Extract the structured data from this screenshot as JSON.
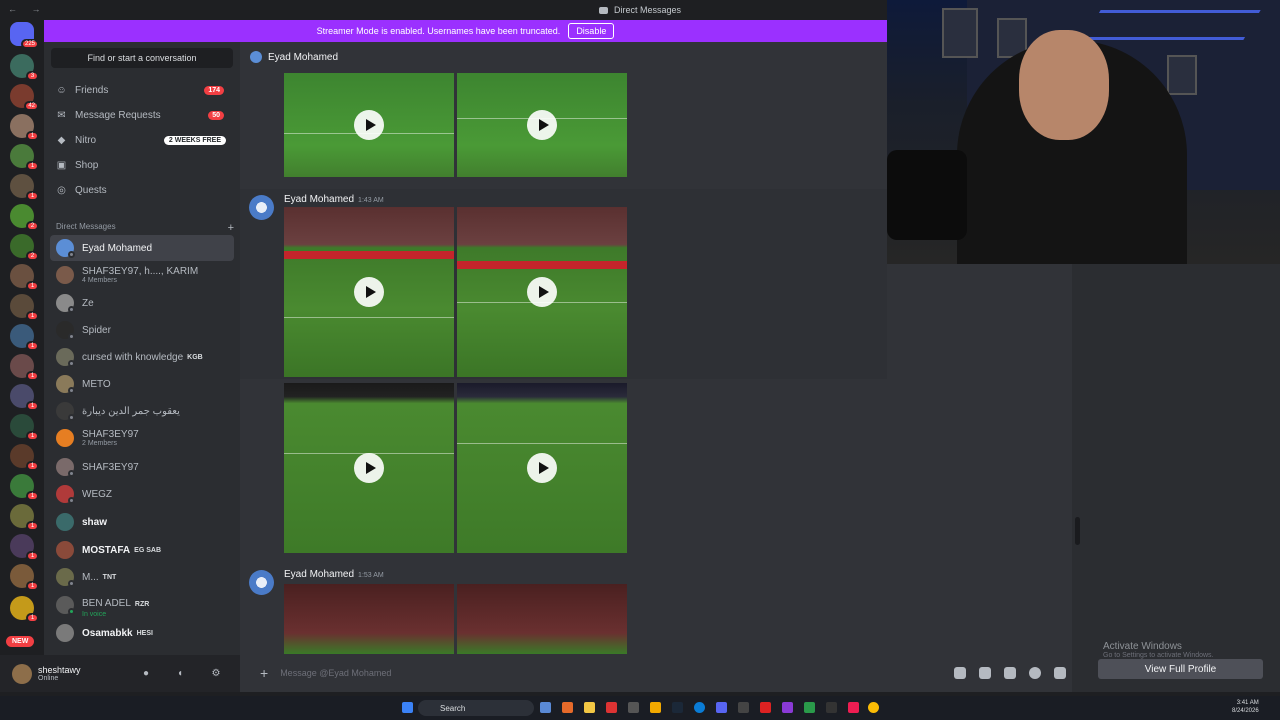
{
  "titlebar": {
    "title": "Direct Messages"
  },
  "streamer": {
    "text": "Streamer Mode is enabled. Usernames have been truncated.",
    "button": "Disable"
  },
  "servers": {
    "home_badge": "225",
    "new_badge": "NEW",
    "badges": [
      "3",
      "42",
      "1",
      "1",
      "1",
      "2",
      "2",
      "1",
      "1",
      "1",
      "1",
      "1",
      "1",
      "1",
      "1",
      "1",
      "1",
      "1",
      "1"
    ]
  },
  "sidebar": {
    "search_placeholder": "Find or start a conversation",
    "nav": [
      {
        "label": "Friends",
        "count": "174"
      },
      {
        "label": "Message Requests",
        "count": "50"
      },
      {
        "label": "Nitro",
        "pill": "2 WEEKS FREE"
      },
      {
        "label": "Shop"
      },
      {
        "label": "Quests"
      }
    ],
    "dm_header": "Direct Messages",
    "dm_add": "+",
    "dms": [
      {
        "name": "Eyad Mohamed",
        "active": true
      },
      {
        "name": "SHAF3EY97, h...., KARIM",
        "sub": "4 Members"
      },
      {
        "name": "Ze"
      },
      {
        "name": "Spider"
      },
      {
        "name": "cursed with knowledge",
        "tag": "KGB"
      },
      {
        "name": "METO"
      },
      {
        "name": "يعقوب جمر الدين ديبارة"
      },
      {
        "name": "SHAF3EY97",
        "sub": "2 Members"
      },
      {
        "name": "SHAF3EY97"
      },
      {
        "name": "WEGZ"
      },
      {
        "name": "shaw",
        "bold": true
      },
      {
        "name": "MOSTAFA",
        "tag": "EG SAB",
        "bold": true
      },
      {
        "name": "M...",
        "tag": "TNT"
      },
      {
        "name": "BEN ADEL",
        "tag": "RZR",
        "sub": "In voice"
      },
      {
        "name": "Osamabkk",
        "tag": "HESI",
        "bold": true
      }
    ]
  },
  "user": {
    "name": "sheshtawy",
    "status": "Online"
  },
  "chat": {
    "header": "Eyad Mohamed",
    "messages": [
      {
        "author": "Eyad Mohamed",
        "time": "1:43 AM"
      },
      {
        "author": "Eyad Mohamed",
        "time": "1:53 AM"
      }
    ],
    "composer_placeholder": "Message @Eyad Mohamed"
  },
  "right": {
    "activate_title": "Activate Windows",
    "activate_sub": "Go to Settings to activate Windows.",
    "view_profile": "View Full Profile"
  },
  "taskbar": {
    "search": "Search",
    "time": "3:41 AM",
    "date": "8/24/2026"
  },
  "colors": {
    "accent": "#5865f2",
    "streamer": "#9b30ff",
    "badge": "#f23f43"
  }
}
